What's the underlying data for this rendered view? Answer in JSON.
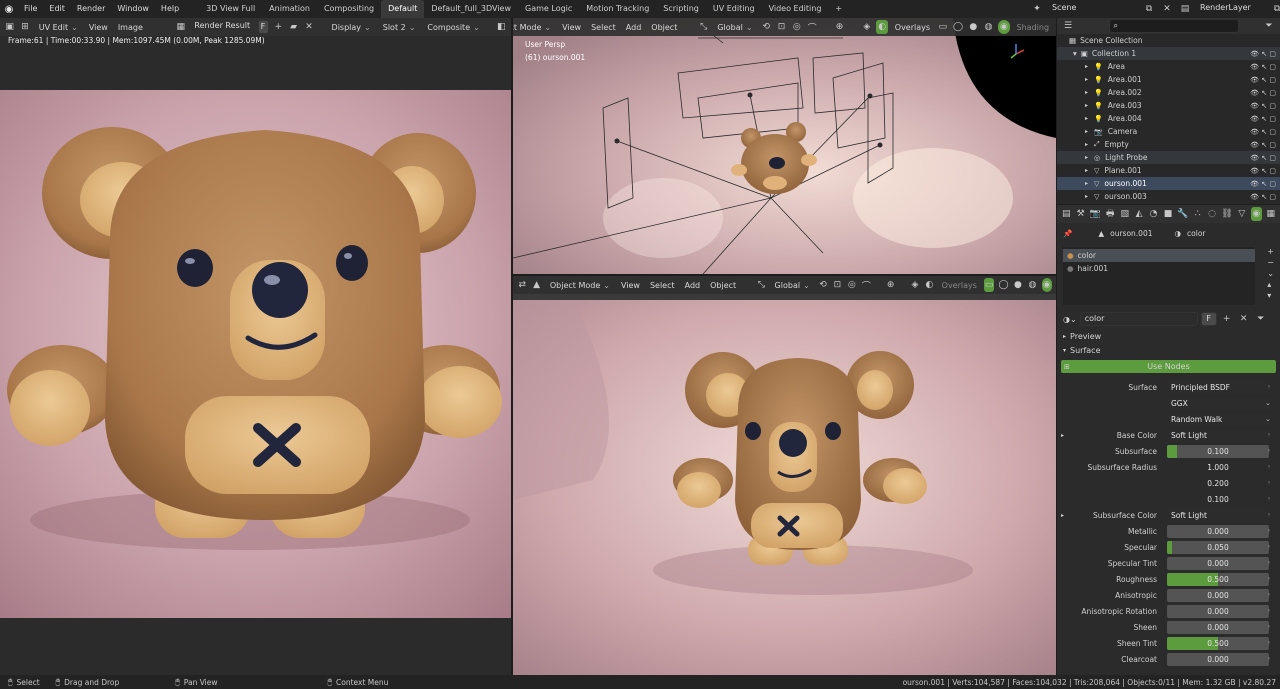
{
  "menu": [
    "File",
    "Edit",
    "Render",
    "Window",
    "Help"
  ],
  "workspaces": [
    {
      "label": "3D View Full",
      "active": false
    },
    {
      "label": "Animation",
      "active": false
    },
    {
      "label": "Compositing",
      "active": false
    },
    {
      "label": "Default",
      "active": true
    },
    {
      "label": "Default_full_3DView",
      "active": false
    },
    {
      "label": "Game Logic",
      "active": false
    },
    {
      "label": "Motion Tracking",
      "active": false
    },
    {
      "label": "Scripting",
      "active": false
    },
    {
      "label": "UV Editing",
      "active": false
    },
    {
      "label": "Video Editing",
      "active": false
    }
  ],
  "add_workspace": "+",
  "scene_name": "Scene",
  "view_layer": "RenderLayer",
  "image_editor": {
    "mode": "UV Edit",
    "view": "View",
    "image": "Image",
    "image_name": "Render Result",
    "fake_user": "F",
    "display": "Display",
    "slot": "Slot 2",
    "pass": "Composite",
    "info": "Frame:61 | Time:00:33.90 | Mem:1097.45M (0.00M, Peak 1285.09M)"
  },
  "viewport_top": {
    "mode": "Object Mode",
    "view": "View",
    "select": "Select",
    "add": "Add",
    "object": "Object",
    "orientation": "Global",
    "overlays": "Overlays",
    "shading": "Shading",
    "persp": "User Persp",
    "active": "(61) ourson.001"
  },
  "viewport_bottom": {
    "mode": "Object Mode",
    "view": "View",
    "select": "Select",
    "add": "Add",
    "object": "Object",
    "orientation": "Global",
    "overlays": "Overlays"
  },
  "outliner": {
    "root": "Scene Collection",
    "collection": "Collection 1",
    "items": [
      {
        "name": "Area",
        "icon": "light-icon",
        "state": "normal"
      },
      {
        "name": "Area.001",
        "icon": "light-icon",
        "state": "normal"
      },
      {
        "name": "Area.002",
        "icon": "light-icon",
        "state": "normal"
      },
      {
        "name": "Area.003",
        "icon": "light-icon",
        "state": "normal"
      },
      {
        "name": "Area.004",
        "icon": "light-icon",
        "state": "normal"
      },
      {
        "name": "Camera",
        "icon": "camera-icon",
        "state": "normal"
      },
      {
        "name": "Empty",
        "icon": "empty-icon",
        "state": "normal"
      },
      {
        "name": "Light Probe",
        "icon": "probe-icon",
        "state": "highlight"
      },
      {
        "name": "Plane.001",
        "icon": "mesh-icon",
        "state": "normal"
      },
      {
        "name": "ourson.001",
        "icon": "mesh-icon",
        "state": "active"
      },
      {
        "name": "ourson.003",
        "icon": "mesh-icon",
        "state": "normal"
      }
    ]
  },
  "properties": {
    "object": "ourson.001",
    "material": "color",
    "slots": [
      "color",
      "hair.001"
    ],
    "material_field": "color",
    "fake_user": "F",
    "preview": "Preview",
    "surface_panel": "Surface",
    "use_nodes": "Use Nodes",
    "rows": [
      {
        "label": "Surface",
        "value": "Principled BSDF",
        "kind": "text"
      },
      {
        "label": "",
        "value": "GGX",
        "kind": "dropdown"
      },
      {
        "label": "",
        "value": "Random Walk",
        "kind": "dropdown"
      },
      {
        "label": "Base Color",
        "value": "Soft Light",
        "kind": "text",
        "expand": true
      },
      {
        "label": "Subsurface",
        "value": "0.100",
        "kind": "num",
        "fill": 0.1
      },
      {
        "label": "Subsurface Radius",
        "value": "1.000",
        "kind": "plain"
      },
      {
        "label": "",
        "value": "0.200",
        "kind": "plain"
      },
      {
        "label": "",
        "value": "0.100",
        "kind": "plain"
      },
      {
        "label": "Subsurface Color",
        "value": "Soft Light",
        "kind": "text",
        "expand": true
      },
      {
        "label": "Metallic",
        "value": "0.000",
        "kind": "num",
        "fill": 0
      },
      {
        "label": "Specular",
        "value": "0.050",
        "kind": "num",
        "fill": 0.05
      },
      {
        "label": "Specular Tint",
        "value": "0.000",
        "kind": "num",
        "fill": 0
      },
      {
        "label": "Roughness",
        "value": "0.500",
        "kind": "num",
        "fill": 0.5
      },
      {
        "label": "Anisotropic",
        "value": "0.000",
        "kind": "num",
        "fill": 0
      },
      {
        "label": "Anisotropic Rotation",
        "value": "0.000",
        "kind": "num",
        "fill": 0
      },
      {
        "label": "Sheen",
        "value": "0.000",
        "kind": "num",
        "fill": 0
      },
      {
        "label": "Sheen Tint",
        "value": "0.500",
        "kind": "num",
        "fill": 0.5
      },
      {
        "label": "Clearcoat",
        "value": "0.000",
        "kind": "num",
        "fill": 0
      }
    ]
  },
  "status": {
    "select": "Select",
    "drag": "Drag and Drop",
    "pan": "Pan View",
    "context": "Context Menu",
    "stats": "ourson.001 | Verts:104,587 | Faces:104,032 | Tris:208,064 | Objects:0/11 | Mem: 1.32 GB | v2.80.27"
  },
  "colors": {
    "accent": "#5c9c3e",
    "selection": "#3d4a5e",
    "header": "#303030"
  }
}
